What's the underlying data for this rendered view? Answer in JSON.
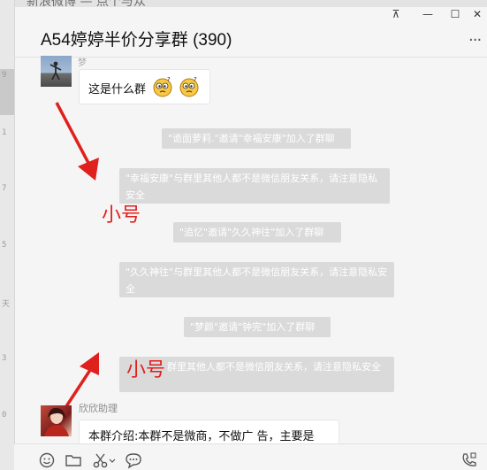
{
  "background_text": "新浪微博  —  点个与众",
  "left_hints": [
    "9",
    "1",
    "7",
    "5",
    "天",
    "3",
    "0"
  ],
  "window_controls": {
    "pin": "⊼",
    "minimize": "—",
    "maximize": "☐",
    "close": "✕"
  },
  "chat": {
    "title": "A54婷婷半价分享群 (390)",
    "more_label": "···"
  },
  "messages": {
    "first_sender_hint": "梦",
    "first_text": "这是什么群",
    "system": [
      "\"诡面萝莉.\"邀请\"幸福安康\"加入了群聊",
      "\"幸福安康\"与群里其他人都不是微信朋友关系，请注意隐私安全",
      "\"追忆\"邀请\"久久神往\"加入了群聊",
      "\"久久神往\"与群里其他人都不是微信朋友关系，请注意隐私安全",
      "\"梦颜\"邀请\"钟完\"加入了群聊",
      "群里其他人都不是微信朋友关系，请注意隐私安全"
    ],
    "second_sender": "欣欣助理",
    "second_text": "本群介绍:本群不是微商，不做广 告，主要是"
  },
  "annotations": {
    "note1": "小号",
    "note2": "小号"
  },
  "colors": {
    "annotation_red": "#e0201c",
    "system_bg": "#dadada",
    "panel_bg": "#f5f5f5"
  },
  "toolbar_icons": [
    "emoji-icon",
    "folder-icon",
    "scissors-icon",
    "chat-bubble-icon",
    "video-call-icon"
  ]
}
